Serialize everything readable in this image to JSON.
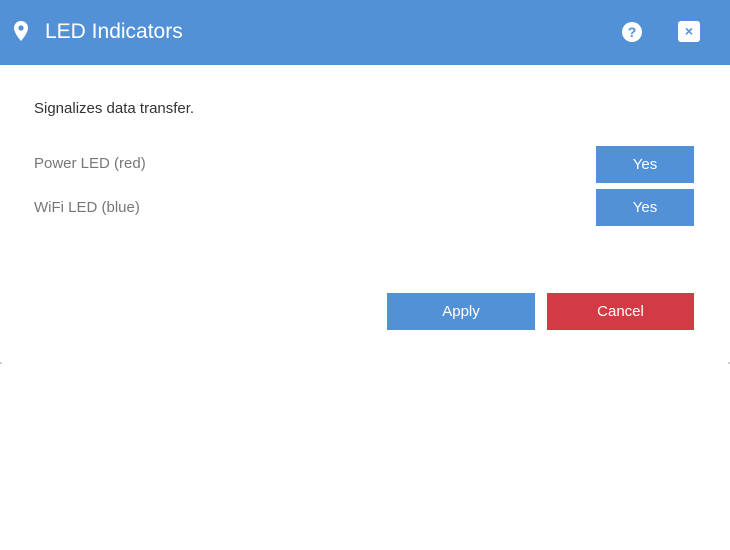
{
  "dialog": {
    "title": "LED Indicators",
    "title_icon": "map-pin-icon",
    "help_label": "?",
    "close_label": "×",
    "description": "Signalizes data transfer."
  },
  "settings": [
    {
      "label": "Power LED (red)",
      "value": "Yes"
    },
    {
      "label": "WiFi LED (blue)",
      "value": "Yes"
    }
  ],
  "actions": {
    "apply_label": "Apply",
    "cancel_label": "Cancel"
  },
  "colors": {
    "accent": "#5291d6",
    "danger": "#d23b45",
    "muted_text": "#777777"
  }
}
